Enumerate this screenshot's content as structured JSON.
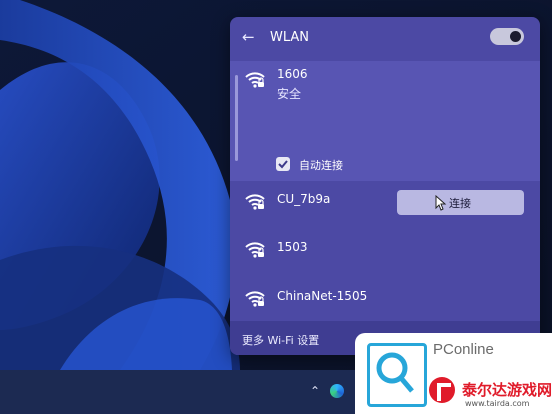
{
  "panel": {
    "title": "WLAN",
    "back_icon": "arrow-left-icon",
    "wifi_enabled": true
  },
  "selected_network": {
    "ssid": "1606",
    "status": "安全",
    "auto_connect_label": "自动连接",
    "auto_connect_checked": true,
    "connect_label": "连接"
  },
  "networks": [
    {
      "ssid": "CU_7b9a",
      "icon": "wifi-secured-icon"
    },
    {
      "ssid": "1503",
      "icon": "wifi-secured-icon"
    },
    {
      "ssid": "ChinaNet-1505",
      "icon": "wifi-secured-icon"
    }
  ],
  "footer": {
    "more_settings_label": "更多 Wi-Fi 设置"
  },
  "watermark": {
    "brand": "PConline",
    "site_name": "泰尔达游戏网",
    "url": "www.tairda.com"
  },
  "colors": {
    "panel_bg": "#4c49a4",
    "selected_bg": "#5855b3",
    "button_bg": "#b9b8e2",
    "brand_red": "#e01b2a",
    "brand_blue": "#27a6d9"
  }
}
